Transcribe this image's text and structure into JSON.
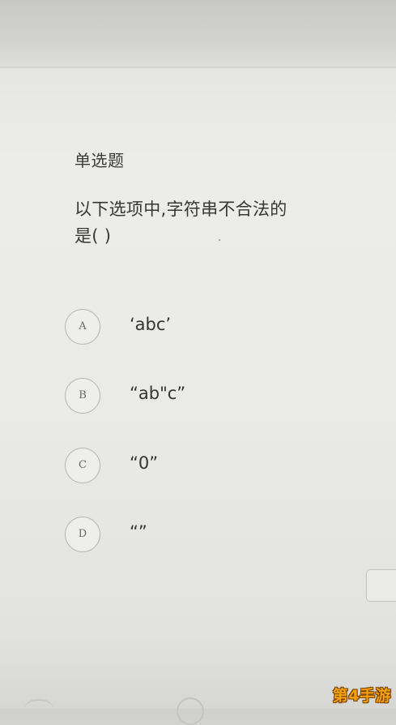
{
  "question": {
    "type_label": "单选题",
    "text_line1": "以下选项中,字符串不合法的",
    "text_line2": "是( )"
  },
  "options": [
    {
      "letter": "A",
      "text": "‘abc’"
    },
    {
      "letter": "B",
      "text": "“ab\"c”"
    },
    {
      "letter": "C",
      "text": "“0”"
    },
    {
      "letter": "D",
      "text": "“”"
    }
  ],
  "watermark": "第4手游",
  "colors": {
    "text": "#363636",
    "circle_border": "#b4b4b4",
    "watermark": "#f3a200"
  }
}
